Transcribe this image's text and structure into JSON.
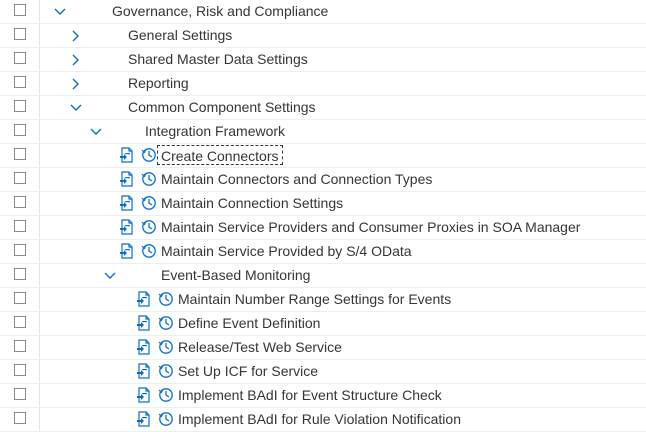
{
  "tree": {
    "rows": [
      {
        "label": "Governance, Risk and Compliance",
        "toggle": "expanded",
        "level": 0,
        "has_actions": false
      },
      {
        "label": "General Settings",
        "toggle": "collapsed",
        "level": 1,
        "has_actions": false
      },
      {
        "label": "Shared Master Data Settings",
        "toggle": "collapsed",
        "level": 1,
        "has_actions": false
      },
      {
        "label": "Reporting",
        "toggle": "collapsed",
        "level": 1,
        "has_actions": false
      },
      {
        "label": "Common Component Settings",
        "toggle": "expanded",
        "level": 1,
        "has_actions": false
      },
      {
        "label": "Integration Framework",
        "toggle": "expanded",
        "level": 2,
        "has_actions": false
      },
      {
        "label": "Create Connectors",
        "toggle": "none",
        "level": 3,
        "has_actions": true,
        "focused": true
      },
      {
        "label": "Maintain Connectors and Connection Types",
        "toggle": "none",
        "level": 3,
        "has_actions": true
      },
      {
        "label": "Maintain Connection Settings",
        "toggle": "none",
        "level": 3,
        "has_actions": true
      },
      {
        "label": "Maintain Service Providers and Consumer Proxies in SOA Manager",
        "toggle": "none",
        "level": 3,
        "has_actions": true
      },
      {
        "label": "Maintain Service Provided by S/4 OData",
        "toggle": "none",
        "level": 3,
        "has_actions": true
      },
      {
        "label": "Event-Based Monitoring",
        "toggle": "expanded",
        "level": 3,
        "has_actions": false
      },
      {
        "label": "Maintain Number Range Settings for Events",
        "toggle": "none",
        "level": 4,
        "has_actions": true
      },
      {
        "label": "Define Event Definition",
        "toggle": "none",
        "level": 4,
        "has_actions": true
      },
      {
        "label": "Release/Test Web Service",
        "toggle": "none",
        "level": 4,
        "has_actions": true
      },
      {
        "label": "Set Up ICF for Service",
        "toggle": "none",
        "level": 4,
        "has_actions": true
      },
      {
        "label": "Implement BAdI for Event Structure Check",
        "toggle": "none",
        "level": 4,
        "has_actions": true
      },
      {
        "label": "Implement BAdI for Rule Violation Notification",
        "toggle": "none",
        "level": 4,
        "has_actions": true
      }
    ],
    "icons": {
      "expanded": "chevron-down-icon",
      "collapsed": "chevron-right-icon",
      "execute": "execute-document-icon",
      "history": "activity-history-icon"
    },
    "colors": {
      "accent": "#0a6ed1",
      "text": "#32363a"
    }
  }
}
